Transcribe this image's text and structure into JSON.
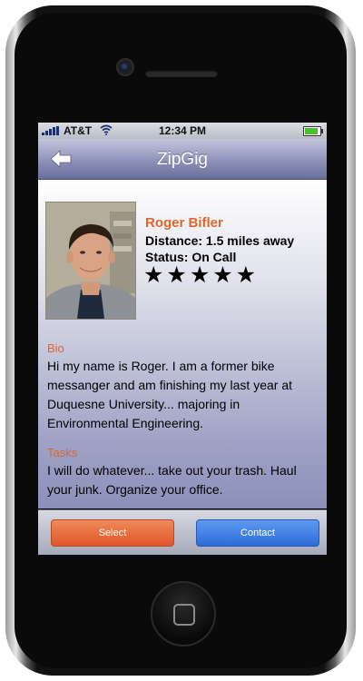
{
  "status_bar": {
    "carrier": "AT&T",
    "time": "12:34 PM",
    "battery_color": "#4ac02e"
  },
  "nav": {
    "title": "ZipGig",
    "back_icon": "back-arrow-icon"
  },
  "profile": {
    "name": "Roger Bifler",
    "distance": "Distance: 1.5 miles away",
    "status": "Status: On Call",
    "rating": 5,
    "rating_max": 5,
    "stars": "★★★★★"
  },
  "bio": {
    "heading": "Bio",
    "text": "Hi my name is Roger.  I am a former bike messanger and am finishing my last year at Duquesne University... majoring in Environmental Engineering."
  },
  "tasks": {
    "heading": "Tasks",
    "text": "I will do whatever... take out your trash.  Haul your junk.  Organize your office."
  },
  "toolbar": {
    "select_label": "Select",
    "contact_label": "Contact"
  },
  "colors": {
    "accent": "#e2662a",
    "select": "#e0562a",
    "contact": "#2d6cd9"
  }
}
